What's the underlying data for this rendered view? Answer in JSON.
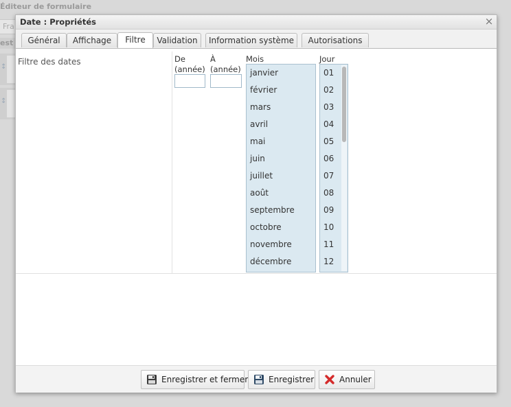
{
  "background": {
    "title": "Éditeur de formulaire",
    "tab_fragment": "Fra",
    "row_fragment": "est"
  },
  "dialog": {
    "title": "Date : Propriétés",
    "close": "×"
  },
  "tabs": [
    {
      "label": "Général"
    },
    {
      "label": "Affichage"
    },
    {
      "label": "Filtre",
      "active": true
    },
    {
      "label": "Validation"
    },
    {
      "label": "Information système"
    },
    {
      "label": "Autorisations"
    }
  ],
  "filter": {
    "section_label": "Filtre des dates",
    "from_label_1": "De",
    "from_label_2": "(année)",
    "to_label_1": "À",
    "to_label_2": "(année)",
    "from_value": "",
    "to_value": "",
    "months_label": "Mois",
    "months": [
      "janvier",
      "février",
      "mars",
      "avril",
      "mai",
      "juin",
      "juillet",
      "août",
      "septembre",
      "octobre",
      "novembre",
      "décembre"
    ],
    "days_label": "Jour",
    "days": [
      "01",
      "02",
      "03",
      "04",
      "05",
      "06",
      "07",
      "08",
      "09",
      "10",
      "11",
      "12"
    ]
  },
  "footer": {
    "save_close": "Enregistrer et fermer",
    "save": "Enregistrer",
    "cancel": "Annuler"
  },
  "icons": {
    "save": "floppy-disk-icon",
    "cancel": "red-x-icon"
  }
}
